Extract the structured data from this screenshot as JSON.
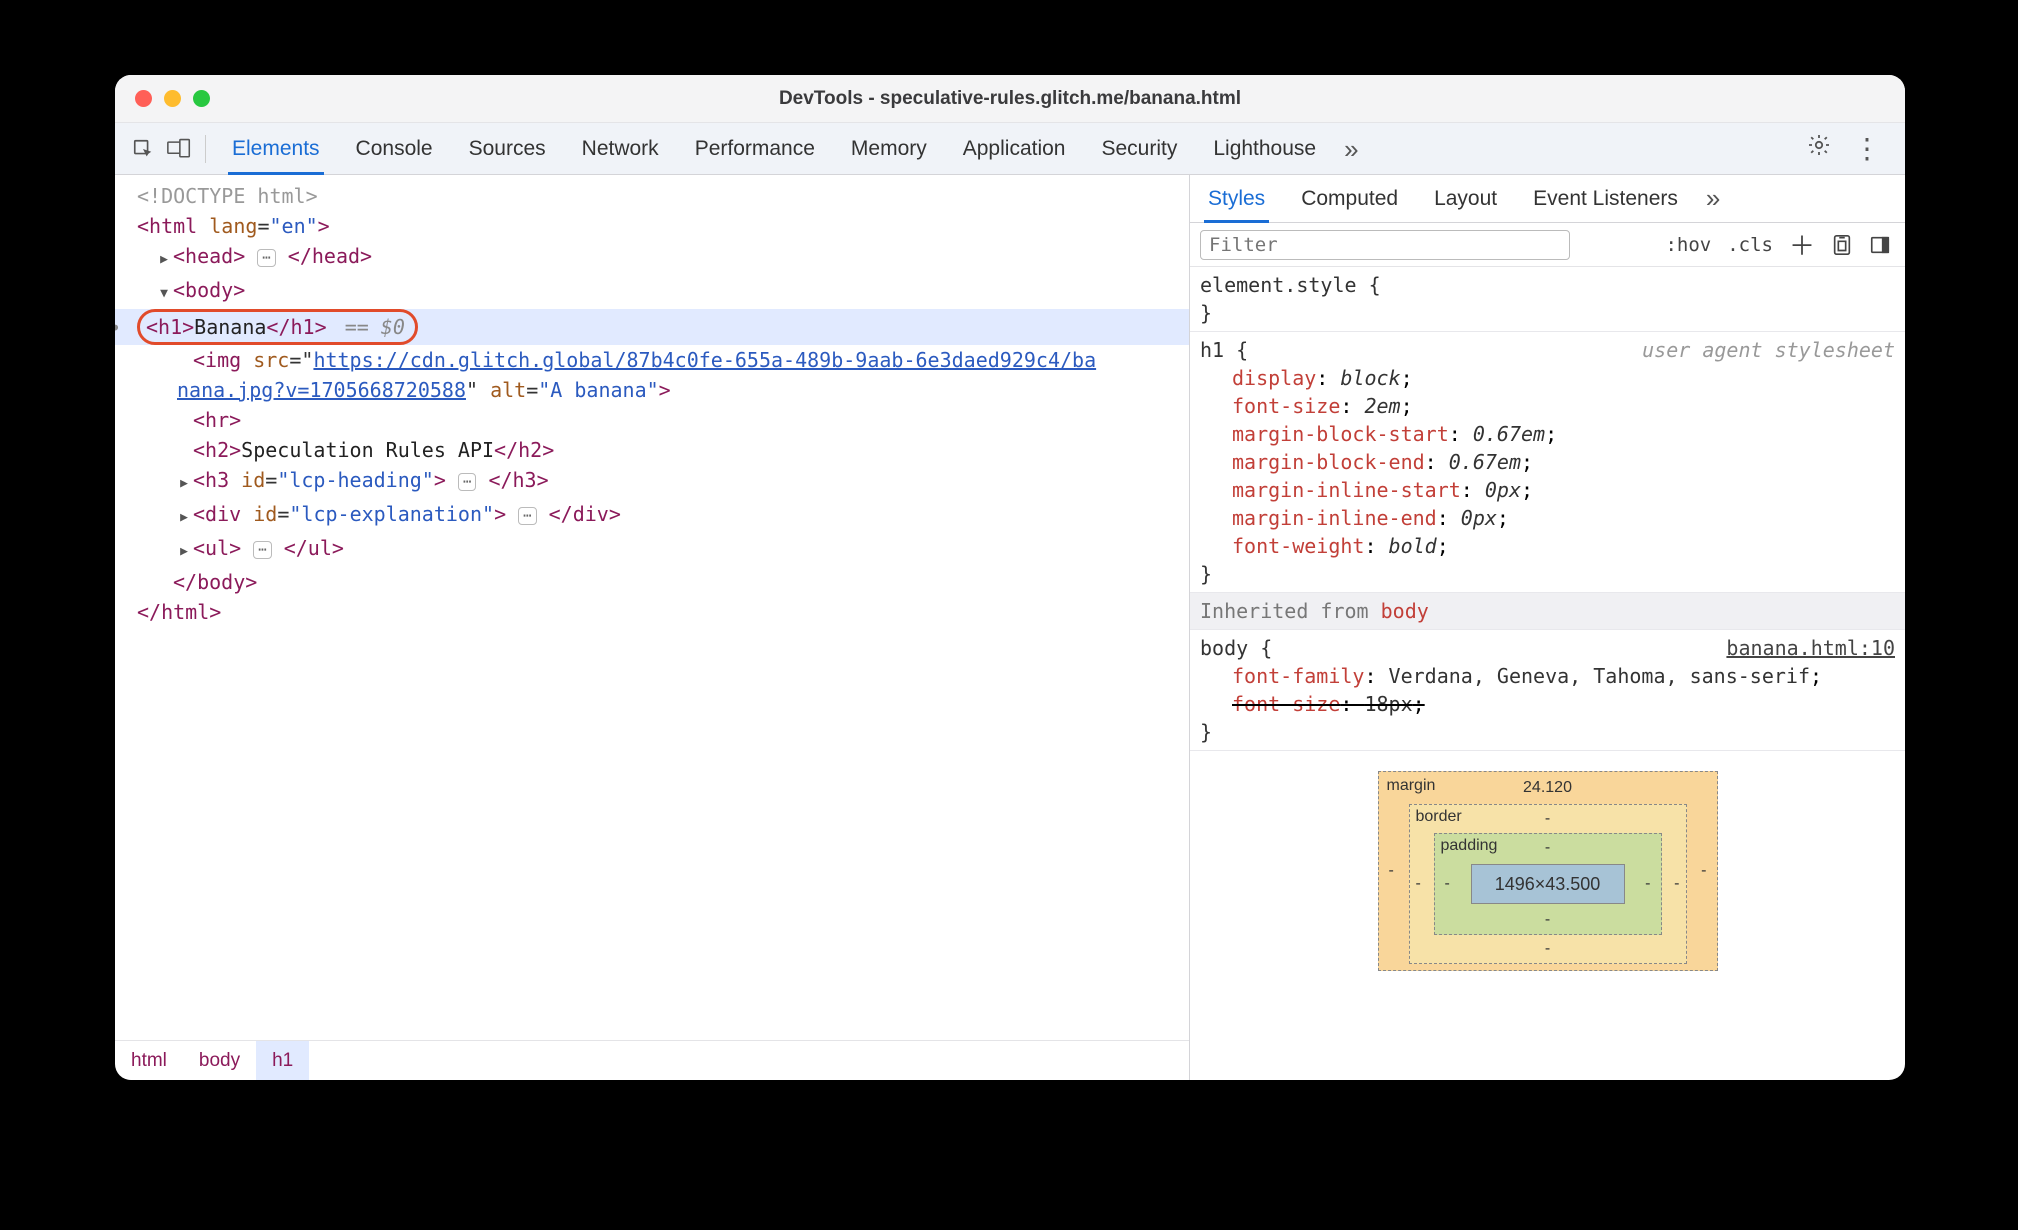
{
  "window": {
    "title": "DevTools - speculative-rules.glitch.me/banana.html"
  },
  "tabs": [
    "Elements",
    "Console",
    "Sources",
    "Network",
    "Performance",
    "Memory",
    "Application",
    "Security",
    "Lighthouse"
  ],
  "active_tab": "Elements",
  "dom": {
    "doctype": "<!DOCTYPE html>",
    "html_open": "<html lang=\"en\">",
    "head_open": "<head>",
    "head_close": "</head>",
    "body_open": "<body>",
    "h1_open": "<h1>",
    "h1_text": "Banana",
    "h1_close": "</h1>",
    "selected_suffix": "== $0",
    "img_prefix": "<img src=\"",
    "img_url1": "https://cdn.glitch.global/87b4c0fe-655a-489b-9aab-6e3daed929c4/ba",
    "img_url2": "nana.jpg?v=1705668720588",
    "img_alt_seg": "\" alt=\"",
    "img_alt": "A banana",
    "img_end": "\">",
    "hr": "<hr>",
    "h2_open": "<h2>",
    "h2_text": "Speculation Rules API",
    "h2_close": "</h2>",
    "h3_line": "<h3 id=\"lcp-heading\">",
    "h3_close": "</h3>",
    "div_line": "<div id=\"lcp-explanation\">",
    "div_close": "</div>",
    "ul_open": "<ul>",
    "ul_close": "</ul>",
    "body_close": "</body>",
    "html_close": "</html>"
  },
  "breadcrumbs": [
    "html",
    "body",
    "h1"
  ],
  "styles_tabs": [
    "Styles",
    "Computed",
    "Layout",
    "Event Listeners"
  ],
  "filter": {
    "placeholder": "Filter",
    "hov": ":hov",
    "cls": ".cls"
  },
  "rules": {
    "element_style": {
      "selector": "element.style",
      "props": []
    },
    "h1": {
      "selector": "h1",
      "origin": "user agent stylesheet",
      "props": [
        {
          "n": "display",
          "v": "block"
        },
        {
          "n": "font-size",
          "v": "2em"
        },
        {
          "n": "margin-block-start",
          "v": "0.67em"
        },
        {
          "n": "margin-block-end",
          "v": "0.67em"
        },
        {
          "n": "margin-inline-start",
          "v": "0px"
        },
        {
          "n": "margin-inline-end",
          "v": "0px"
        },
        {
          "n": "font-weight",
          "v": "bold"
        }
      ]
    },
    "inherited_label": "Inherited from",
    "inherited_from": "body",
    "body": {
      "selector": "body",
      "source": "banana.html:10",
      "props": [
        {
          "n": "font-family",
          "v": "Verdana, Geneva, Tahoma, sans-serif",
          "strike": false
        },
        {
          "n": "font-size",
          "v": "18px",
          "strike": true
        }
      ]
    }
  },
  "boxmodel": {
    "margin_label": "margin",
    "margin_top": "24.120",
    "border_label": "border",
    "border_top": "-",
    "padding_label": "padding",
    "padding_top": "-",
    "content": "1496×43.500",
    "dash": "-"
  }
}
